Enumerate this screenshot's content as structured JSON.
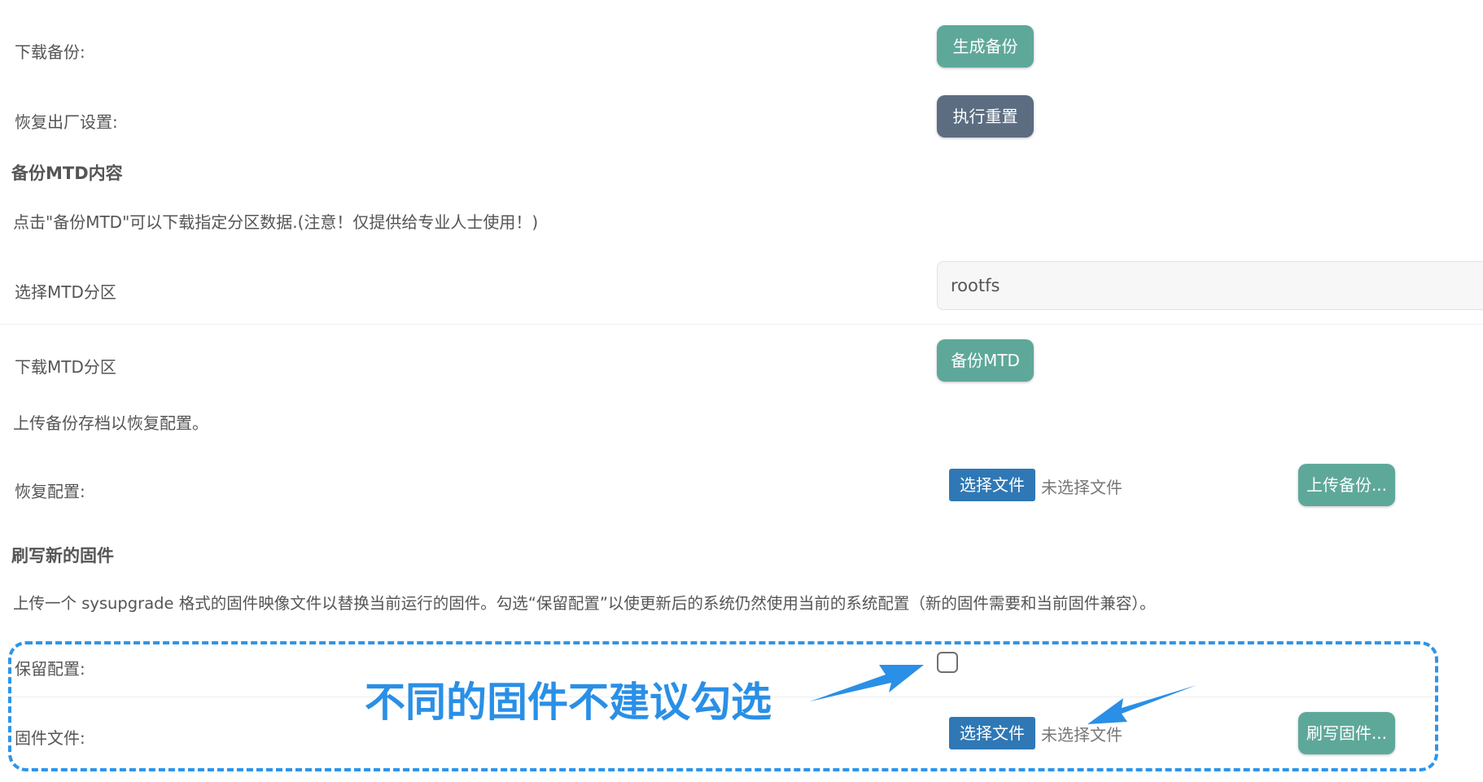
{
  "backup": {
    "download_label": "下载备份:",
    "generate_button": "生成备份",
    "reset_label": "恢复出厂设置:",
    "reset_button": "执行重置"
  },
  "mtd": {
    "heading": "备份MTD内容",
    "description": "点击\"备份MTD\"可以下载指定分区数据.(注意！仅提供给专业人士使用！)",
    "select_label": "选择MTD分区",
    "select_value": "rootfs",
    "download_label": "下载MTD分区",
    "backup_button": "备份MTD"
  },
  "restore": {
    "description": "上传备份存档以恢复配置。",
    "label": "恢复配置:",
    "choose_button": "选择文件",
    "no_file": "未选择文件",
    "upload_button": "上传备份..."
  },
  "flash": {
    "heading": "刷写新的固件",
    "description": "上传一个 sysupgrade 格式的固件映像文件以替换当前运行的固件。勾选“保留配置”以使更新后的系统仍然使用当前的系统配置（新的固件需要和当前固件兼容）。",
    "keep_label": "保留配置:",
    "file_label": "固件文件:",
    "choose_button": "选择文件",
    "no_file": "未选择文件",
    "flash_button": "刷写固件..."
  },
  "annotation": {
    "text": "不同的固件不建议勾选"
  },
  "colors": {
    "teal_button": "#5ea89a",
    "slate_button": "#5c6d82",
    "blue_button": "#2f78b5",
    "annotation_blue": "#2a8fe6"
  }
}
